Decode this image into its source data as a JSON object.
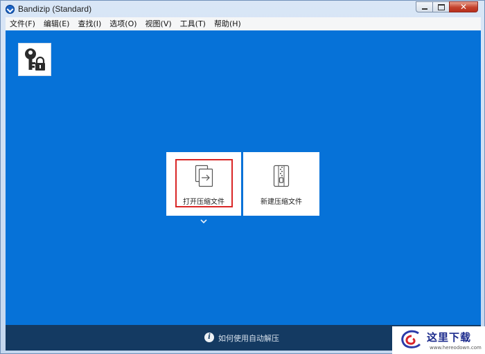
{
  "window": {
    "title": "Bandizip (Standard)"
  },
  "menu": [
    {
      "label": "文件(F)",
      "name": "menu-file"
    },
    {
      "label": "编辑(E)",
      "name": "menu-edit"
    },
    {
      "label": "查找(I)",
      "name": "menu-find"
    },
    {
      "label": "选项(O)",
      "name": "menu-options"
    },
    {
      "label": "视图(V)",
      "name": "menu-view"
    },
    {
      "label": "工具(T)",
      "name": "menu-tools"
    },
    {
      "label": "帮助(H)",
      "name": "menu-help"
    }
  ],
  "tiles": {
    "open_label": "打开压缩文件",
    "new_label": "新建压缩文件"
  },
  "footer": {
    "help_text": "如何使用自动解压"
  },
  "watermark": {
    "text": "这里下载",
    "url": "www.hereodown.com"
  },
  "colors": {
    "content_bg": "#0672d8",
    "footer_bg": "#143a62",
    "highlight": "#d92525"
  }
}
